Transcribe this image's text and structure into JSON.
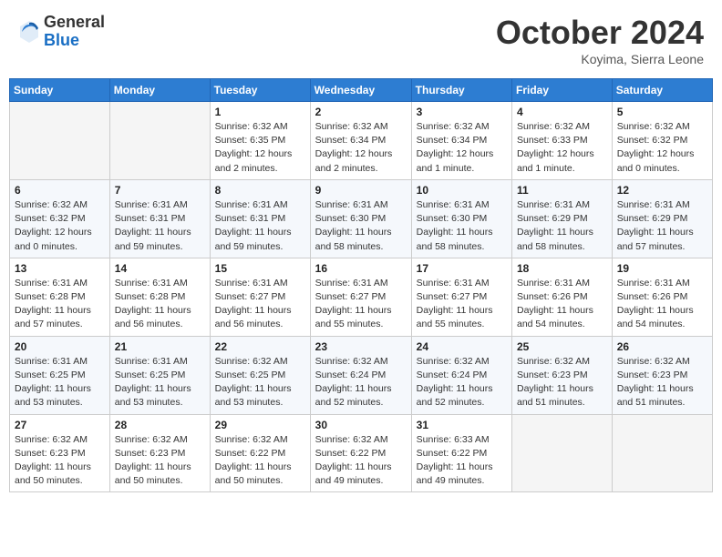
{
  "header": {
    "logo_general": "General",
    "logo_blue": "Blue",
    "month_title": "October 2024",
    "location": "Koyima, Sierra Leone"
  },
  "days_of_week": [
    "Sunday",
    "Monday",
    "Tuesday",
    "Wednesday",
    "Thursday",
    "Friday",
    "Saturday"
  ],
  "weeks": [
    [
      {
        "day": "",
        "sunrise": "",
        "sunset": "",
        "daylight": ""
      },
      {
        "day": "",
        "sunrise": "",
        "sunset": "",
        "daylight": ""
      },
      {
        "day": "1",
        "sunrise": "Sunrise: 6:32 AM",
        "sunset": "Sunset: 6:35 PM",
        "daylight": "Daylight: 12 hours and 2 minutes."
      },
      {
        "day": "2",
        "sunrise": "Sunrise: 6:32 AM",
        "sunset": "Sunset: 6:34 PM",
        "daylight": "Daylight: 12 hours and 2 minutes."
      },
      {
        "day": "3",
        "sunrise": "Sunrise: 6:32 AM",
        "sunset": "Sunset: 6:34 PM",
        "daylight": "Daylight: 12 hours and 1 minute."
      },
      {
        "day": "4",
        "sunrise": "Sunrise: 6:32 AM",
        "sunset": "Sunset: 6:33 PM",
        "daylight": "Daylight: 12 hours and 1 minute."
      },
      {
        "day": "5",
        "sunrise": "Sunrise: 6:32 AM",
        "sunset": "Sunset: 6:32 PM",
        "daylight": "Daylight: 12 hours and 0 minutes."
      }
    ],
    [
      {
        "day": "6",
        "sunrise": "Sunrise: 6:32 AM",
        "sunset": "Sunset: 6:32 PM",
        "daylight": "Daylight: 12 hours and 0 minutes."
      },
      {
        "day": "7",
        "sunrise": "Sunrise: 6:31 AM",
        "sunset": "Sunset: 6:31 PM",
        "daylight": "Daylight: 11 hours and 59 minutes."
      },
      {
        "day": "8",
        "sunrise": "Sunrise: 6:31 AM",
        "sunset": "Sunset: 6:31 PM",
        "daylight": "Daylight: 11 hours and 59 minutes."
      },
      {
        "day": "9",
        "sunrise": "Sunrise: 6:31 AM",
        "sunset": "Sunset: 6:30 PM",
        "daylight": "Daylight: 11 hours and 58 minutes."
      },
      {
        "day": "10",
        "sunrise": "Sunrise: 6:31 AM",
        "sunset": "Sunset: 6:30 PM",
        "daylight": "Daylight: 11 hours and 58 minutes."
      },
      {
        "day": "11",
        "sunrise": "Sunrise: 6:31 AM",
        "sunset": "Sunset: 6:29 PM",
        "daylight": "Daylight: 11 hours and 58 minutes."
      },
      {
        "day": "12",
        "sunrise": "Sunrise: 6:31 AM",
        "sunset": "Sunset: 6:29 PM",
        "daylight": "Daylight: 11 hours and 57 minutes."
      }
    ],
    [
      {
        "day": "13",
        "sunrise": "Sunrise: 6:31 AM",
        "sunset": "Sunset: 6:28 PM",
        "daylight": "Daylight: 11 hours and 57 minutes."
      },
      {
        "day": "14",
        "sunrise": "Sunrise: 6:31 AM",
        "sunset": "Sunset: 6:28 PM",
        "daylight": "Daylight: 11 hours and 56 minutes."
      },
      {
        "day": "15",
        "sunrise": "Sunrise: 6:31 AM",
        "sunset": "Sunset: 6:27 PM",
        "daylight": "Daylight: 11 hours and 56 minutes."
      },
      {
        "day": "16",
        "sunrise": "Sunrise: 6:31 AM",
        "sunset": "Sunset: 6:27 PM",
        "daylight": "Daylight: 11 hours and 55 minutes."
      },
      {
        "day": "17",
        "sunrise": "Sunrise: 6:31 AM",
        "sunset": "Sunset: 6:27 PM",
        "daylight": "Daylight: 11 hours and 55 minutes."
      },
      {
        "day": "18",
        "sunrise": "Sunrise: 6:31 AM",
        "sunset": "Sunset: 6:26 PM",
        "daylight": "Daylight: 11 hours and 54 minutes."
      },
      {
        "day": "19",
        "sunrise": "Sunrise: 6:31 AM",
        "sunset": "Sunset: 6:26 PM",
        "daylight": "Daylight: 11 hours and 54 minutes."
      }
    ],
    [
      {
        "day": "20",
        "sunrise": "Sunrise: 6:31 AM",
        "sunset": "Sunset: 6:25 PM",
        "daylight": "Daylight: 11 hours and 53 minutes."
      },
      {
        "day": "21",
        "sunrise": "Sunrise: 6:31 AM",
        "sunset": "Sunset: 6:25 PM",
        "daylight": "Daylight: 11 hours and 53 minutes."
      },
      {
        "day": "22",
        "sunrise": "Sunrise: 6:32 AM",
        "sunset": "Sunset: 6:25 PM",
        "daylight": "Daylight: 11 hours and 53 minutes."
      },
      {
        "day": "23",
        "sunrise": "Sunrise: 6:32 AM",
        "sunset": "Sunset: 6:24 PM",
        "daylight": "Daylight: 11 hours and 52 minutes."
      },
      {
        "day": "24",
        "sunrise": "Sunrise: 6:32 AM",
        "sunset": "Sunset: 6:24 PM",
        "daylight": "Daylight: 11 hours and 52 minutes."
      },
      {
        "day": "25",
        "sunrise": "Sunrise: 6:32 AM",
        "sunset": "Sunset: 6:23 PM",
        "daylight": "Daylight: 11 hours and 51 minutes."
      },
      {
        "day": "26",
        "sunrise": "Sunrise: 6:32 AM",
        "sunset": "Sunset: 6:23 PM",
        "daylight": "Daylight: 11 hours and 51 minutes."
      }
    ],
    [
      {
        "day": "27",
        "sunrise": "Sunrise: 6:32 AM",
        "sunset": "Sunset: 6:23 PM",
        "daylight": "Daylight: 11 hours and 50 minutes."
      },
      {
        "day": "28",
        "sunrise": "Sunrise: 6:32 AM",
        "sunset": "Sunset: 6:23 PM",
        "daylight": "Daylight: 11 hours and 50 minutes."
      },
      {
        "day": "29",
        "sunrise": "Sunrise: 6:32 AM",
        "sunset": "Sunset: 6:22 PM",
        "daylight": "Daylight: 11 hours and 50 minutes."
      },
      {
        "day": "30",
        "sunrise": "Sunrise: 6:32 AM",
        "sunset": "Sunset: 6:22 PM",
        "daylight": "Daylight: 11 hours and 49 minutes."
      },
      {
        "day": "31",
        "sunrise": "Sunrise: 6:33 AM",
        "sunset": "Sunset: 6:22 PM",
        "daylight": "Daylight: 11 hours and 49 minutes."
      },
      {
        "day": "",
        "sunrise": "",
        "sunset": "",
        "daylight": ""
      },
      {
        "day": "",
        "sunrise": "",
        "sunset": "",
        "daylight": ""
      }
    ]
  ]
}
